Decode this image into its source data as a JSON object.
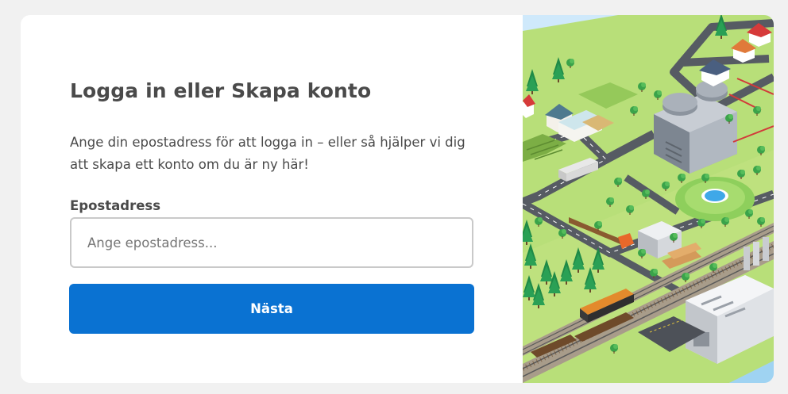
{
  "login": {
    "title": "Logga in eller Skapa konto",
    "description": "Ange din epostadress för att logga in – eller så hjälper vi dig att skapa ett konto om du är ny här!",
    "email_label": "Epostadress",
    "email_placeholder": "Ange epostadress...",
    "email_value": "",
    "next_label": "Nästa"
  },
  "colors": {
    "primary": "#0a72d2",
    "grass": "#b8df79",
    "road": "#565b63",
    "water": "#cfe9fb"
  },
  "illustration": {
    "name": "isometric-industry-landscape"
  }
}
